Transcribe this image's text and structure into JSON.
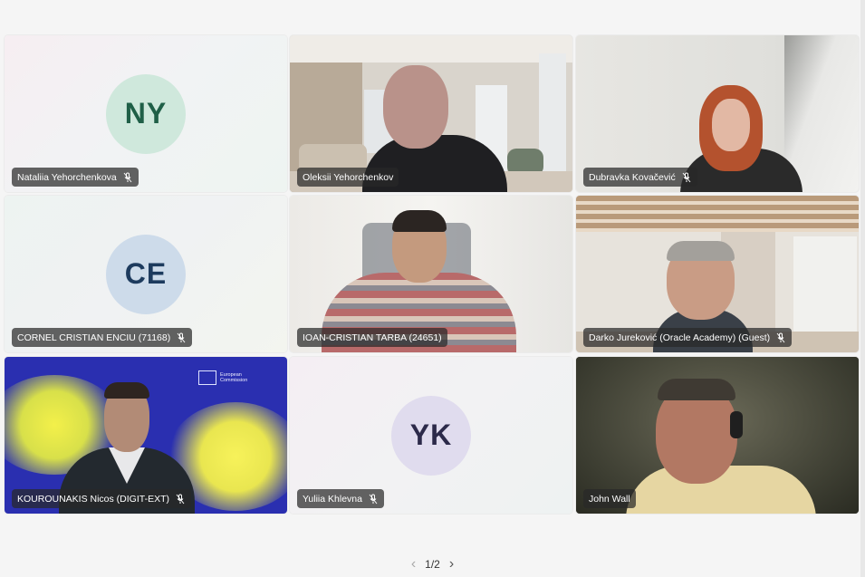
{
  "participants": [
    {
      "name": "Nataliia Yehorchenkova",
      "initials": "NY",
      "muted": true,
      "video": false,
      "avatar_bg": "#cfe8dc",
      "avatar_fg": "#1f5f47"
    },
    {
      "name": "Oleksii Yehorchenkov",
      "muted": false,
      "video": true
    },
    {
      "name": "Dubravka Kovačević",
      "muted": true,
      "video": true
    },
    {
      "name": "CORNEL CRISTIAN ENCIU (71168)",
      "initials": "CE",
      "muted": true,
      "video": false,
      "avatar_bg": "#cddbea",
      "avatar_fg": "#1d3b5e"
    },
    {
      "name": "IOAN-CRISTIAN TARBA (24651)",
      "muted": false,
      "video": true
    },
    {
      "name": "Darko Jureković (Oracle Academy) (Guest)",
      "muted": true,
      "video": true
    },
    {
      "name": "KOUROUNAKIS Nicos (DIGIT-EXT)",
      "muted": true,
      "video": true,
      "background_text": "European Commission"
    },
    {
      "name": "Yuliia Khlevna",
      "initials": "YK",
      "muted": true,
      "video": false,
      "avatar_bg": "#e0dcee",
      "avatar_fg": "#2c2a4a"
    },
    {
      "name": "John Wall",
      "muted": false,
      "video": true
    }
  ],
  "pager": {
    "label": "1/2",
    "prev_icon": "chevron-left-icon",
    "next_icon": "chevron-right-icon"
  }
}
